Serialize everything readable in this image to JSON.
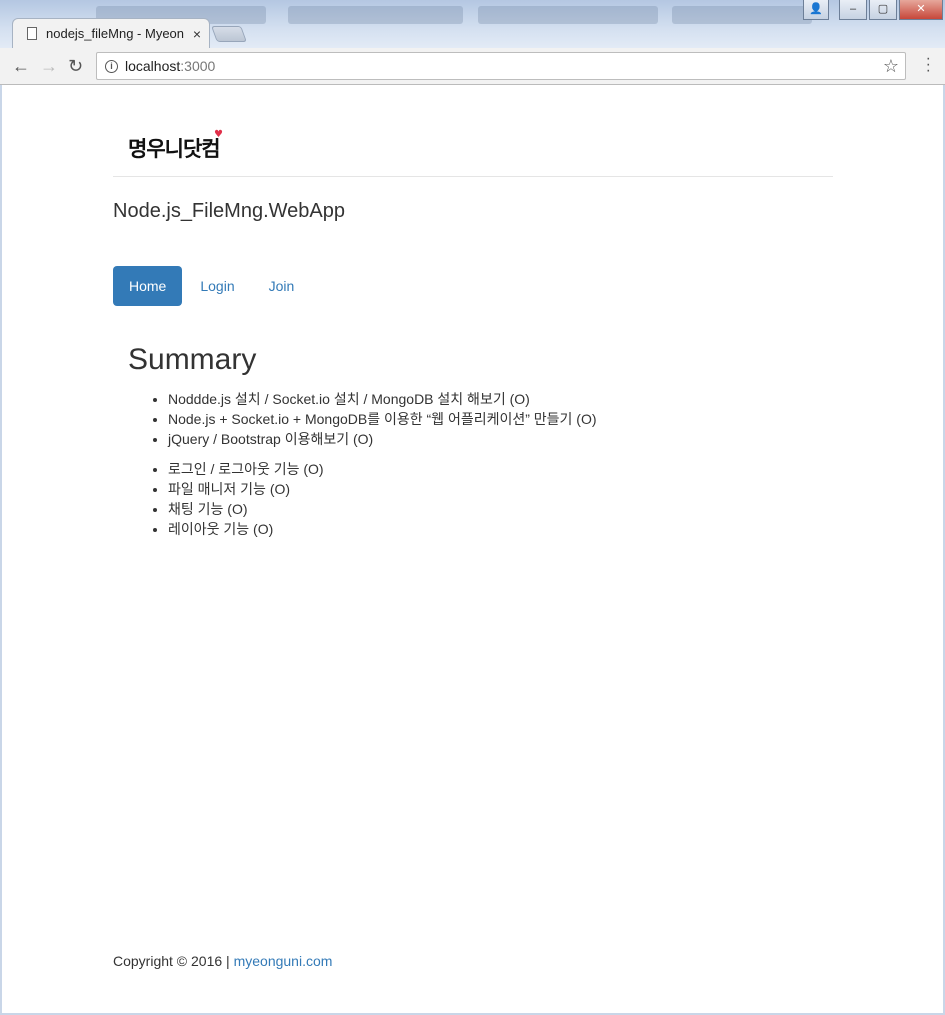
{
  "browser": {
    "tab_title": "nodejs_fileMng - Myeon",
    "tab_close": "×",
    "address_host": "localhost",
    "address_port": ":3000",
    "window_controls": {
      "minimize": "‒",
      "maximize": "▢",
      "close": "✕"
    }
  },
  "page": {
    "logo_text": "명우니닷컴",
    "app_title": "Node.js_FileMng.WebApp",
    "nav": [
      {
        "label": "Home",
        "active": true
      },
      {
        "label": "Login",
        "active": false
      },
      {
        "label": "Join",
        "active": false
      }
    ],
    "summary_title": "Summary",
    "list1": [
      "Noddde.js 설치 / Socket.io 설치 / MongoDB 설치 해보기 (O)",
      "Node.js + Socket.io + MongoDB를 이용한 “웹 어플리케이션” 만들기 (O)",
      "jQuery / Bootstrap 이용해보기 (O)"
    ],
    "list2": [
      "로그인 / 로그아웃 기능 (O)",
      "파일 매니저 기능 (O)",
      "채팅 기능 (O)",
      "레이아웃 기능 (O)"
    ],
    "footer_text": "Copyright © 2016 | ",
    "footer_link": "myeonguni.com"
  },
  "colors": {
    "accent": "#337ab7",
    "text": "#333333"
  }
}
